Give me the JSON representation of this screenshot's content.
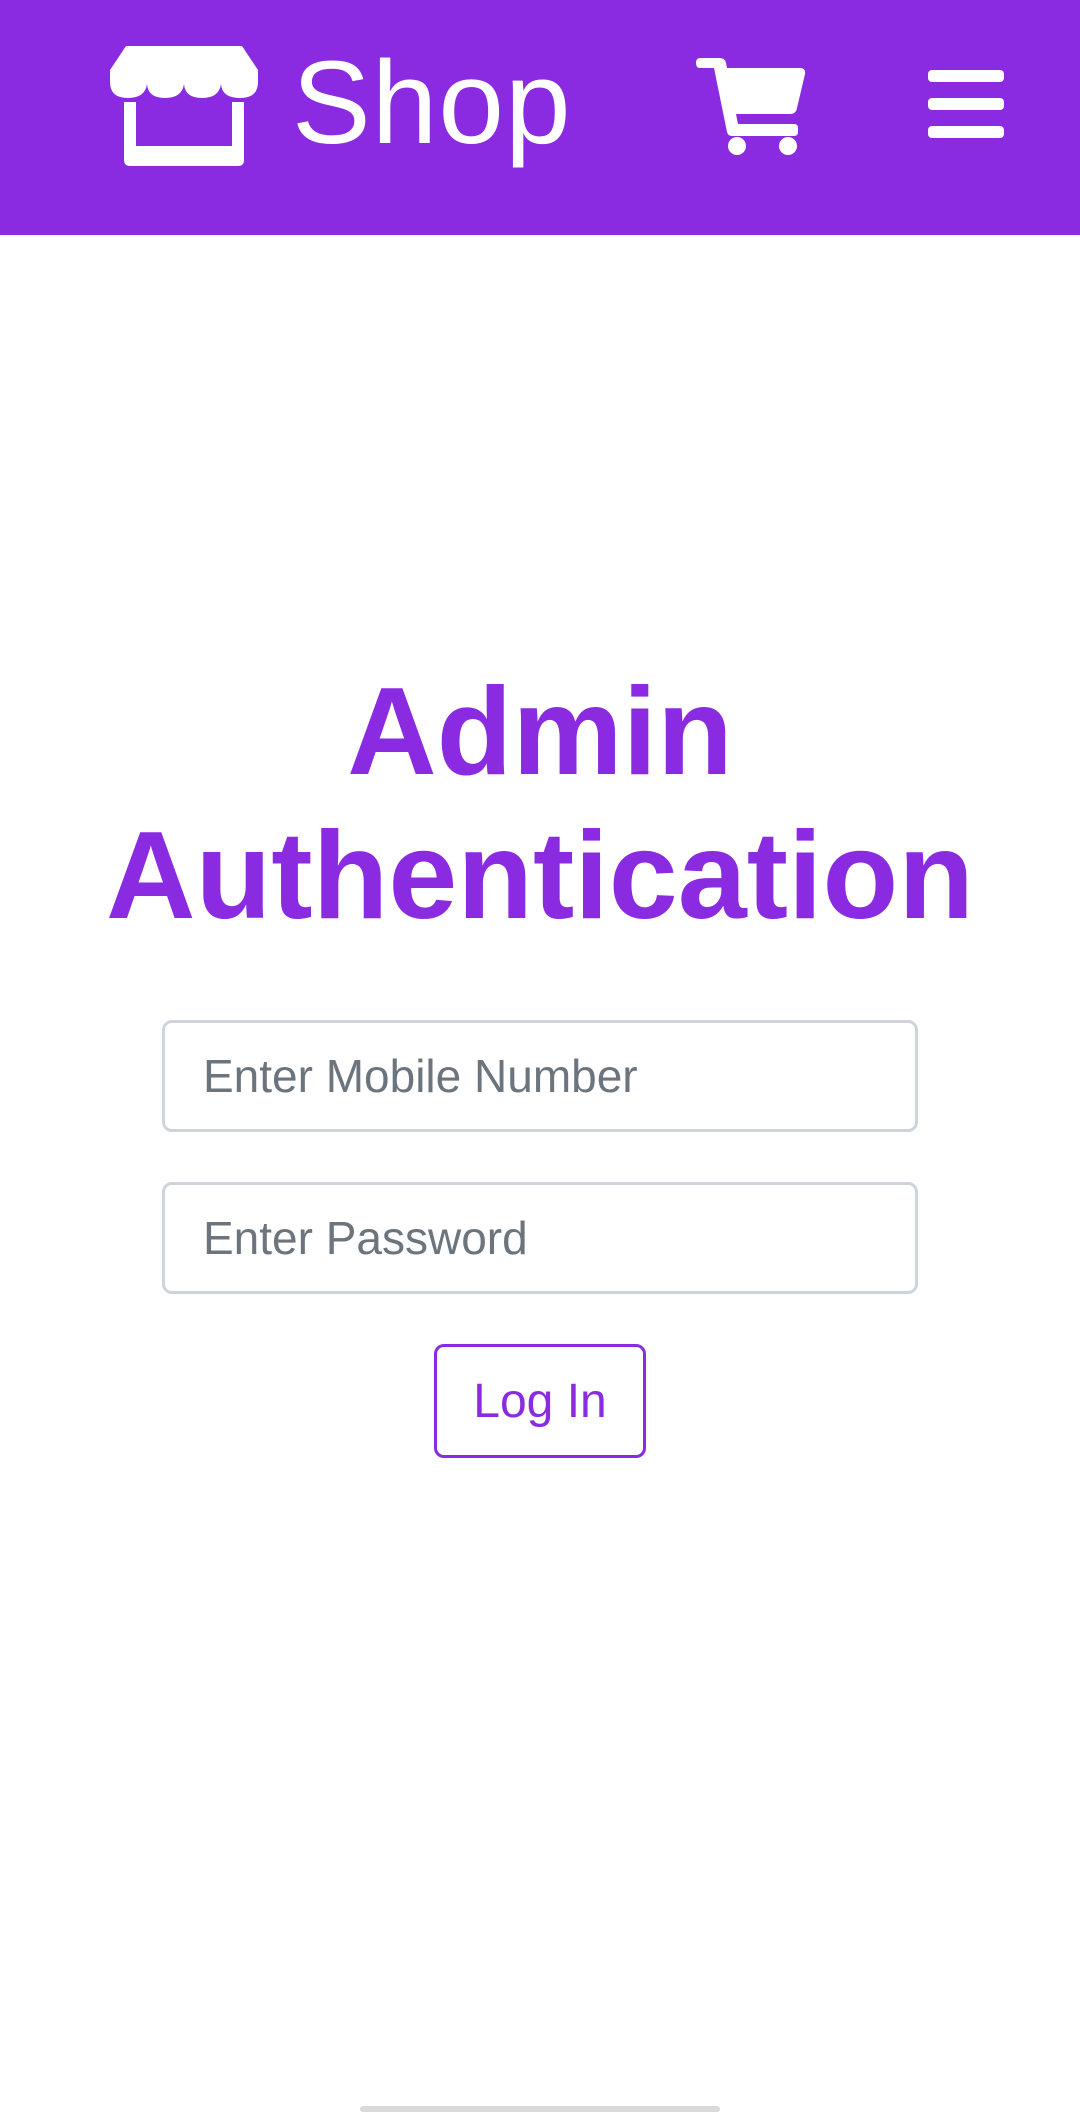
{
  "header": {
    "brand_name": "Shop",
    "brand_icon": "store-icon",
    "cart_icon": "cart-icon",
    "menu_icon": "hamburger-menu-icon",
    "background_color": "#8a2be2"
  },
  "main": {
    "title_line1": "Admin",
    "title_line2": "Authentication",
    "mobile_placeholder": "Enter Mobile Number",
    "mobile_value": "",
    "password_placeholder": "Enter Password",
    "password_value": "",
    "login_label": "Log In",
    "accent_color": "#8a2be2"
  }
}
